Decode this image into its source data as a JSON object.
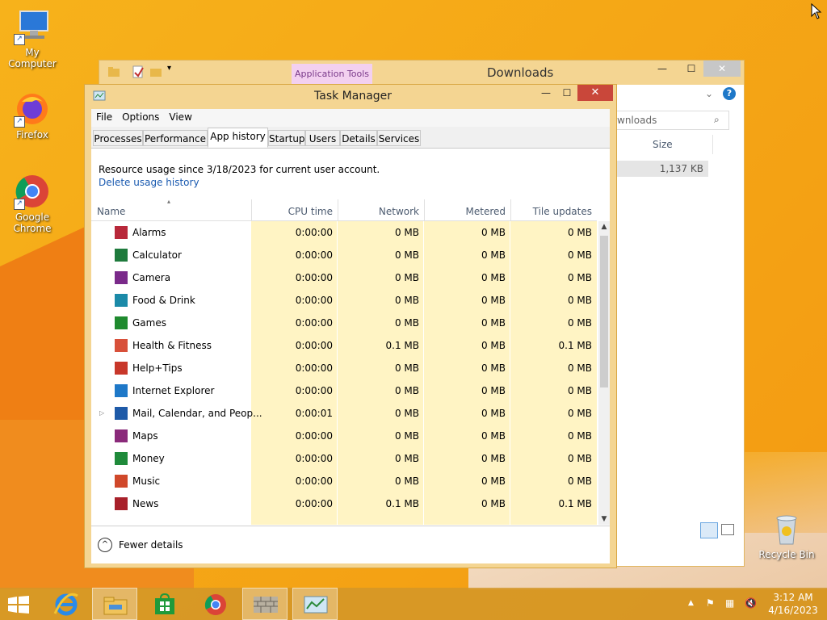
{
  "desktop": {
    "icons": [
      {
        "label": "My Computer"
      },
      {
        "label": "Firefox"
      },
      {
        "label": "Google Chrome"
      },
      {
        "label": "Recycle Bin"
      }
    ]
  },
  "explorer": {
    "title": "Downloads",
    "ribbon_context": "Application Tools",
    "search_placeholder": "wnloads",
    "column_size": "Size",
    "file_size": "1,137 KB"
  },
  "task_manager": {
    "title": "Task Manager",
    "menu": [
      "File",
      "Options",
      "View"
    ],
    "tabs": [
      "Processes",
      "Performance",
      "App history",
      "Startup",
      "Users",
      "Details",
      "Services"
    ],
    "active_tab": "App history",
    "resource_text": "Resource usage since 3/18/2023 for current user account.",
    "delete_link": "Delete usage history",
    "columns": {
      "name": "Name",
      "cpu": "CPU time",
      "network": "Network",
      "metered": "Metered network",
      "tile": "Tile updates"
    },
    "rows": [
      {
        "name": "Alarms",
        "cpu": "0:00:00",
        "network": "0 MB",
        "metered": "0 MB",
        "tile": "0 MB",
        "icon_color": "#b8283a"
      },
      {
        "name": "Calculator",
        "cpu": "0:00:00",
        "network": "0 MB",
        "metered": "0 MB",
        "tile": "0 MB",
        "icon_color": "#1e7a3c"
      },
      {
        "name": "Camera",
        "cpu": "0:00:00",
        "network": "0 MB",
        "metered": "0 MB",
        "tile": "0 MB",
        "icon_color": "#7a2a8a"
      },
      {
        "name": "Food & Drink",
        "cpu": "0:00:00",
        "network": "0 MB",
        "metered": "0 MB",
        "tile": "0 MB",
        "icon_color": "#1b8aa8"
      },
      {
        "name": "Games",
        "cpu": "0:00:00",
        "network": "0 MB",
        "metered": "0 MB",
        "tile": "0 MB",
        "icon_color": "#1f8a2e"
      },
      {
        "name": "Health & Fitness",
        "cpu": "0:00:00",
        "network": "0.1 MB",
        "metered": "0 MB",
        "tile": "0.1 MB",
        "icon_color": "#d8503a"
      },
      {
        "name": "Help+Tips",
        "cpu": "0:00:00",
        "network": "0 MB",
        "metered": "0 MB",
        "tile": "0 MB",
        "icon_color": "#c8372a"
      },
      {
        "name": "Internet Explorer",
        "cpu": "0:00:00",
        "network": "0 MB",
        "metered": "0 MB",
        "tile": "0 MB",
        "icon_color": "#1e78c8"
      },
      {
        "name": "Mail, Calendar, and Peop...",
        "cpu": "0:00:01",
        "network": "0 MB",
        "metered": "0 MB",
        "tile": "0 MB",
        "icon_color": "#1e5aa8"
      },
      {
        "name": "Maps",
        "cpu": "0:00:00",
        "network": "0 MB",
        "metered": "0 MB",
        "tile": "0 MB",
        "icon_color": "#8a2a7a"
      },
      {
        "name": "Money",
        "cpu": "0:00:00",
        "network": "0 MB",
        "metered": "0 MB",
        "tile": "0 MB",
        "icon_color": "#1f8a3a"
      },
      {
        "name": "Music",
        "cpu": "0:00:00",
        "network": "0 MB",
        "metered": "0 MB",
        "tile": "0 MB",
        "icon_color": "#d0482a"
      },
      {
        "name": "News",
        "cpu": "0:00:00",
        "network": "0.1 MB",
        "metered": "0 MB",
        "tile": "0.1 MB",
        "icon_color": "#a8202a"
      }
    ],
    "footer_label": "Fewer details"
  },
  "taskbar": {
    "time": "3:12 AM",
    "date": "4/16/2023"
  },
  "colors": {
    "wallpaper": "#f5a716",
    "window_frame": "#f4d592",
    "close_button": "#c9473a",
    "link": "#1a5ab0",
    "column_highlight": "#fff4c4"
  }
}
